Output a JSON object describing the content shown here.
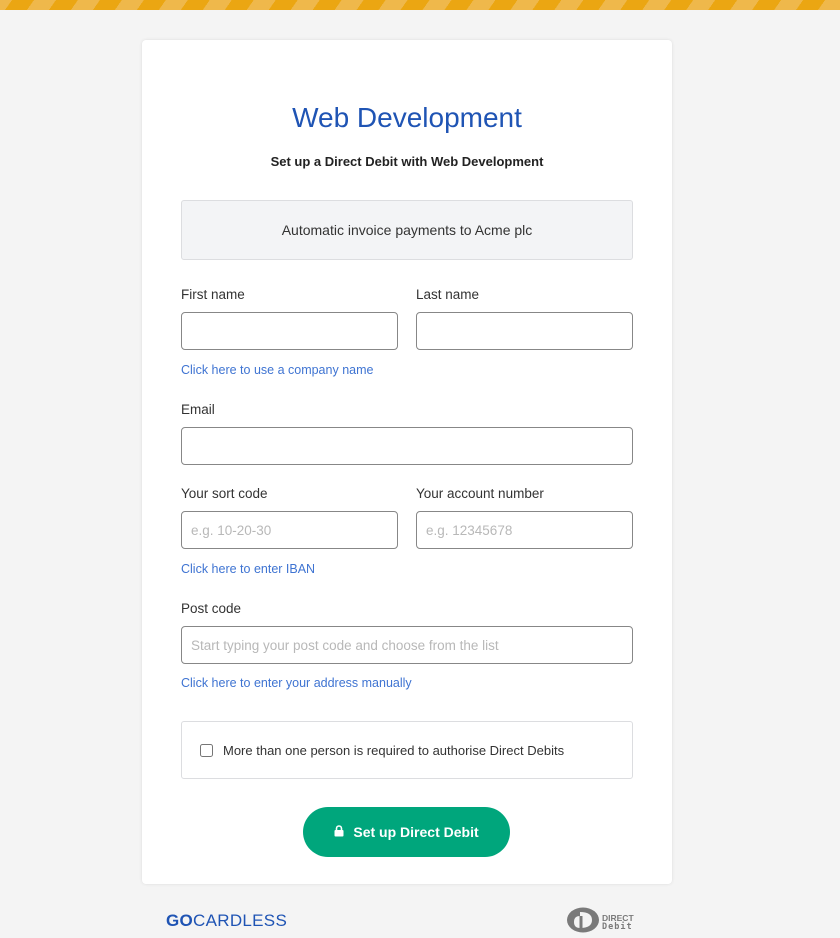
{
  "page": {
    "title": "Web Development",
    "subtitle": "Set up a Direct Debit with Web Development",
    "description": "Automatic invoice payments to Acme plc"
  },
  "colors": {
    "brand_blue": "#1f54b4",
    "link_blue": "#3f74d2",
    "button_green": "#00a67c",
    "stripe_light": "#efb84b",
    "stripe_dark": "#eba612"
  },
  "form": {
    "first_name": {
      "label": "First name",
      "value": "",
      "placeholder": ""
    },
    "last_name": {
      "label": "Last name",
      "value": "",
      "placeholder": ""
    },
    "company_link": "Click here to use a company name",
    "email": {
      "label": "Email",
      "value": "",
      "placeholder": ""
    },
    "sort_code": {
      "label": "Your sort code",
      "value": "",
      "placeholder": "e.g. 10-20-30"
    },
    "account_number": {
      "label": "Your account number",
      "value": "",
      "placeholder": "e.g. 12345678"
    },
    "iban_link": "Click here to enter IBAN",
    "post_code": {
      "label": "Post code",
      "value": "",
      "placeholder": "Start typing your post code and choose from the list"
    },
    "address_link": "Click here to enter your address manually",
    "multi_auth": {
      "label": "More than one person is required to authorise Direct Debits",
      "checked": false
    },
    "submit_label": "Set up Direct Debit",
    "submit_icon": "lock-icon"
  },
  "footer": {
    "gocardless_go": "GO",
    "gocardless_rest": "CARDLESS",
    "direct_debit_line1": "DIRECT",
    "direct_debit_line2": "Debit"
  }
}
